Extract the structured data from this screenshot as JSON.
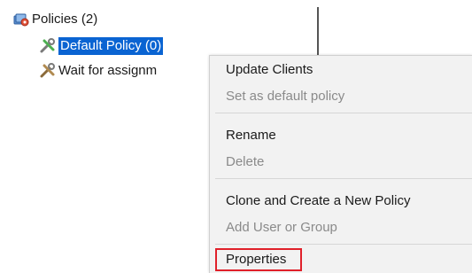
{
  "tree": {
    "root_label": "Policies (2)",
    "items": [
      {
        "label": "Default Policy (0)",
        "selected": true
      },
      {
        "label": "Wait for assignm"
      }
    ]
  },
  "context_menu": {
    "groups": [
      [
        {
          "label": "Update Clients",
          "enabled": true
        },
        {
          "label": "Set as default policy",
          "enabled": false
        }
      ],
      [
        {
          "label": "Rename",
          "enabled": true
        },
        {
          "label": "Delete",
          "enabled": false
        }
      ],
      [
        {
          "label": "Clone and Create a New Policy",
          "enabled": true
        },
        {
          "label": "Add User or Group",
          "enabled": false
        }
      ],
      [
        {
          "label": "Properties",
          "enabled": true,
          "highlighted": true
        }
      ]
    ]
  },
  "colors": {
    "selection": "#0a64d2",
    "highlight_box": "#e0202a",
    "disabled_text": "#8a8a8a"
  },
  "icons": {
    "root": "policies-folder-icon",
    "default_policy": "policy-tools-green-icon",
    "wait_policy": "policy-tools-icon"
  }
}
